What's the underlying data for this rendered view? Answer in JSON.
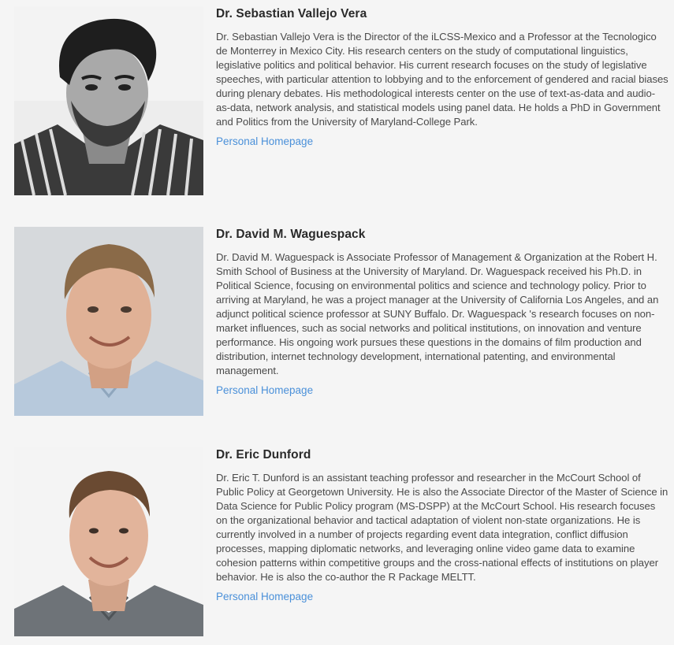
{
  "people": [
    {
      "name": "Dr. Sebastian Vallejo Vera",
      "bio": "Dr. Sebastian Vallejo Vera is the Director of the iLCSS-Mexico and a Professor at the Tecnologico de Monterrey in Mexico City. His research centers on the study of computational linguistics, legislative politics and political behavior. His current research focuses on the study of legislative speeches, with particular attention to lobbying and to the enforcement of gendered and racial biases during plenary debates. His methodological interests center on the use of text-as-data and audio-as-data, network analysis, and statistical models using panel data. He holds a PhD in Government and Politics from the University of Maryland-College Park.",
      "link_label": "Personal Homepage",
      "photo_alt": "Photo of Dr. Sebastian Vallejo Vera"
    },
    {
      "name": "Dr. David M. Waguespack",
      "bio": "Dr. David M. Waguespack is Associate Professor of Management & Organization at the Robert H. Smith School of Business at the University of Maryland. Dr. Waguespack received his Ph.D. in Political Science, focusing on environmental politics and science and technology policy. Prior to arriving at Maryland, he was a project manager at the University of California Los Angeles, and an adjunct political science professor at SUNY Buffalo. Dr. Waguespack 's research focuses on non-market influences, such as social networks and political institutions, on innovation and venture performance. His ongoing work pursues these questions in the domains of film production and distribution, internet technology development, international patenting, and environmental management.",
      "link_label": "Personal Homepage",
      "photo_alt": "Photo of Dr. David M. Waguespack"
    },
    {
      "name": "Dr. Eric Dunford",
      "bio": "Dr. Eric T. Dunford is an assistant teaching professor and researcher in the McCourt School of Public Policy at Georgetown University. He is also the Associate Director of the Master of Science in Data Science for Public Policy program (MS-DSPP) at the McCourt School. His research focuses on the organizational behavior and tactical adaptation of violent non-state organizations. He is currently involved in a number of projects regarding event data integration, conflict diffusion processes, mapping diplomatic networks, and leveraging online video game data to examine cohesion patterns within competitive groups and the cross-national effects of institutions on player behavior. He is also the co-author the R Package MELTT.",
      "link_label": "Personal Homepage",
      "photo_alt": "Photo of Dr. Eric Dunford"
    }
  ],
  "colors": {
    "background": "#f5f5f5",
    "name_text": "#2a2a2a",
    "body_text": "#4a4a4a",
    "link": "#4a90d9"
  }
}
